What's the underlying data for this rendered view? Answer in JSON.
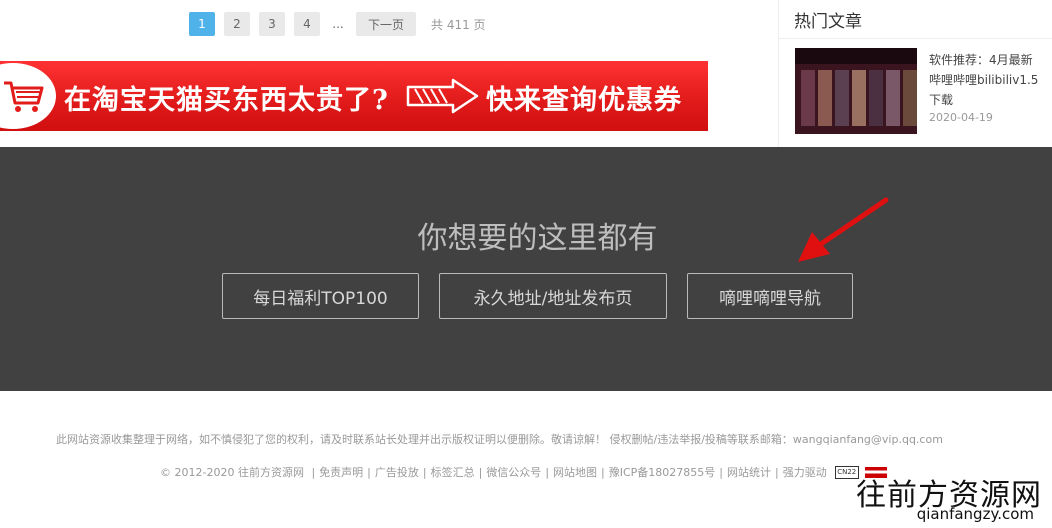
{
  "pagination": {
    "pages": [
      "1",
      "2",
      "3",
      "4"
    ],
    "ellipsis": "...",
    "next": "下一页",
    "total": "共 411 页"
  },
  "promo": {
    "left_text": "在淘宝天猫买东西太贵了?",
    "right_text": "快来查询优惠券",
    "bg_color": "#e82222"
  },
  "hot": {
    "title": "热门文章",
    "article": {
      "line1": "软件推荐：4月最新",
      "line2": "哔哩哔哩bilibiliv1.5",
      "line3": "下载",
      "date": "2020-04-19"
    }
  },
  "banner": {
    "headline": "你想要的这里都有",
    "buttons": [
      "每日福利TOP100",
      "永久地址/地址发布页",
      "嘀哩嘀哩导航"
    ]
  },
  "footer": {
    "disclaimer": "此网站资源收集整理于网络，如不慎侵犯了您的权利，请及时联系站长处理并出示版权证明以便删除。敬请谅解！ 侵权删帖/违法举报/投稿等联系邮箱：wangqianfang@vip.qq.com",
    "copyright": "© 2012-2020 往前方资源网",
    "links": [
      "免责声明",
      "广告投放",
      "标签汇总",
      "微信公众号",
      "网站地图",
      "豫ICP备18027855号",
      "网站统计",
      "强力驱动"
    ],
    "badge": "CN22"
  },
  "watermark": {
    "cn": "往前方资源网",
    "en": "qianfangzy.com"
  }
}
